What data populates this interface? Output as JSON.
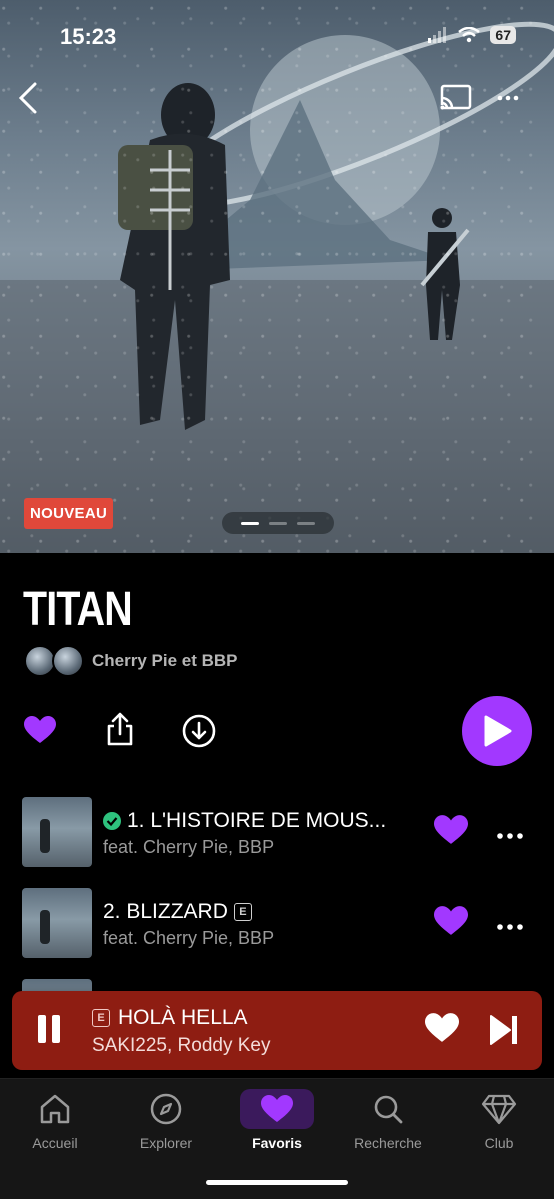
{
  "status": {
    "time": "15:23",
    "battery": "67"
  },
  "hero": {
    "badge": "NOUVEAU"
  },
  "album": {
    "title": "TITAN",
    "artists": "Cherry Pie et BBP"
  },
  "tracks": [
    {
      "title": "1. L'HISTOIRE DE MOUS...",
      "subtitle": "feat. Cherry Pie, BBP",
      "downloaded": true,
      "explicit": false
    },
    {
      "title": "2. BLIZZARD",
      "subtitle": "feat. Cherry Pie, BBP",
      "downloaded": false,
      "explicit": true,
      "explicit_label": "E"
    }
  ],
  "mini_player": {
    "explicit_label": "E",
    "title": "HOLÀ HELLA",
    "artists": "SAKI225, Roddy Key"
  },
  "tabs": [
    {
      "label": "Accueil",
      "icon": "home-icon"
    },
    {
      "label": "Explorer",
      "icon": "compass-icon"
    },
    {
      "label": "Favoris",
      "icon": "heart-icon",
      "active": true
    },
    {
      "label": "Recherche",
      "icon": "search-icon"
    },
    {
      "label": "Club",
      "icon": "diamond-icon"
    }
  ],
  "colors": {
    "accent": "#a238ff",
    "badge": "#e0483a",
    "mini_player": "#8e1d12",
    "downloaded": "#2ec27e"
  }
}
